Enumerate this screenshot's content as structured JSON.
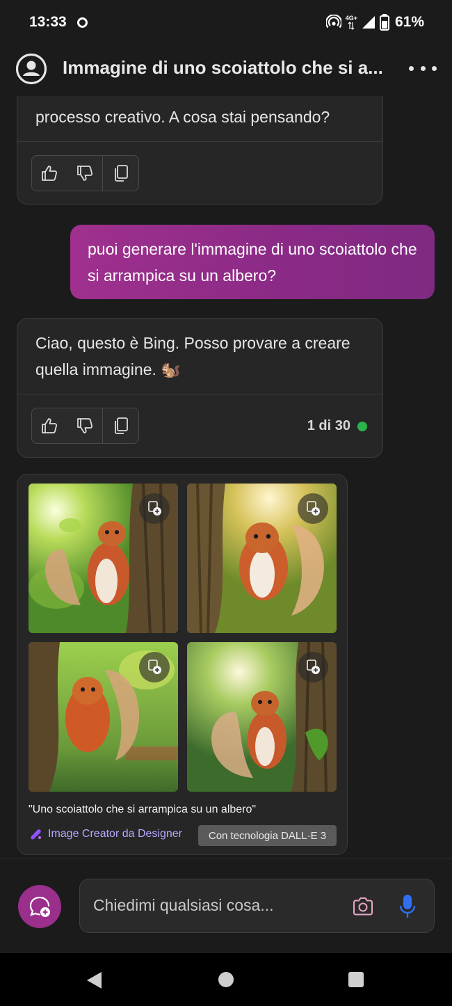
{
  "status_bar": {
    "time": "13:33",
    "network": "4G+",
    "battery": "61%"
  },
  "header": {
    "title": "Immagine di uno scoiattolo che si a...",
    "more_icon": "more-horizontal-icon"
  },
  "messages": {
    "bot_1": {
      "text": "processo creativo. A cosa stai pensando?"
    },
    "user_1": {
      "text": "puoi generare l'immagine di uno scoiattolo che si arrampica su un albero?"
    },
    "bot_2": {
      "text": "Ciao, questo è Bing. Posso provare a creare quella immagine. 🐿️",
      "counter": "1 di 30"
    }
  },
  "image_result": {
    "caption": "\"Uno scoiattolo che si arrampica su un albero\"",
    "creator_label": "Image Creator da Designer",
    "badge": "Con tecnologia DALL·E 3",
    "images": [
      "squirrel-image-1",
      "squirrel-image-2",
      "squirrel-image-3",
      "squirrel-image-4"
    ]
  },
  "input": {
    "placeholder": "Chiedimi qualsiasi cosa..."
  },
  "colors": {
    "accent": "#9a2f8c",
    "user_bubble": "#a0308e",
    "creator_text": "#b9a8ff",
    "mic": "#2f6ff0",
    "status_ok": "#2bb24c"
  }
}
